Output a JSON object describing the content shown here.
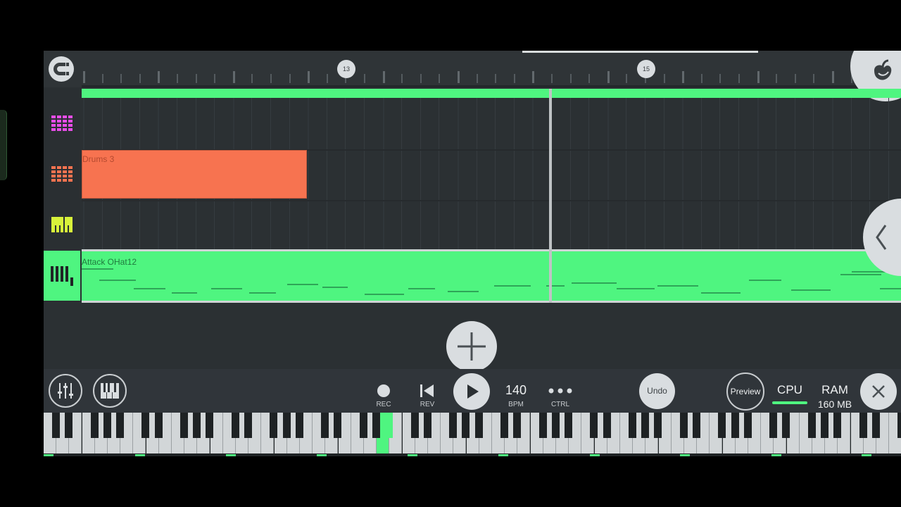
{
  "ruler": {
    "markers": [
      {
        "label": "13"
      },
      {
        "label": "15"
      }
    ]
  },
  "tracks": [
    {
      "icon": "pattern-grid-icon",
      "color": "#e84de8"
    },
    {
      "icon": "pattern-grid-icon",
      "color": "#f77350"
    },
    {
      "icon": "piano-roll-icon",
      "color": "#d8f23a"
    },
    {
      "icon": "piano-roll-icon",
      "color": "#222222",
      "active": true
    }
  ],
  "clips": {
    "drums": {
      "label": "Drums 3",
      "color": "#f77350"
    },
    "hat": {
      "label": "Attack OHat12",
      "color": "#4ff580"
    }
  },
  "transport": {
    "rec_label": "REC",
    "rev_label": "REV",
    "bpm_value": "140",
    "bpm_label": "BPM",
    "ctrl_label": "CTRL",
    "undo_label": "Undo",
    "preview_label": "Preview",
    "cpu_label": "CPU",
    "ram_label": "RAM",
    "ram_value": "160 MB"
  },
  "colors": {
    "accent": "#4ff580",
    "background": "#2b3033",
    "button": "#d9dde0"
  }
}
